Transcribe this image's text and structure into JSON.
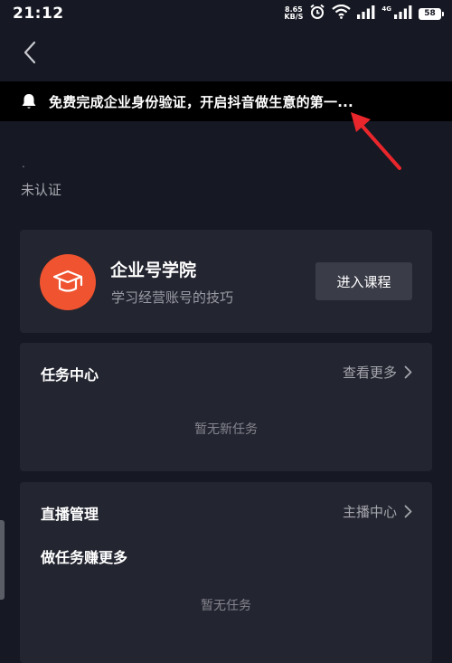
{
  "status_bar": {
    "time": "21:12",
    "net_speed_value": "8.65",
    "net_speed_unit": "KB/S",
    "network_type": "4G",
    "battery": "58"
  },
  "notice": {
    "text": "免费完成企业身份验证，开启抖音做生意的第一..."
  },
  "account": {
    "dot": ".",
    "status": "未认证"
  },
  "academy": {
    "title": "企业号学院",
    "subtitle": "学习经营账号的技巧",
    "button_label": "进入课程"
  },
  "task_center": {
    "title": "任务中心",
    "link_label": "查看更多",
    "empty_text": "暂无新任务"
  },
  "live_management": {
    "title": "直播管理",
    "link_label": "主播中心",
    "subtitle": "做任务赚更多",
    "empty_text": "暂无任务"
  },
  "colors": {
    "background": "#161823",
    "card": "#232530",
    "accent": "#f0532f",
    "annotation_arrow": "#e8262b"
  }
}
